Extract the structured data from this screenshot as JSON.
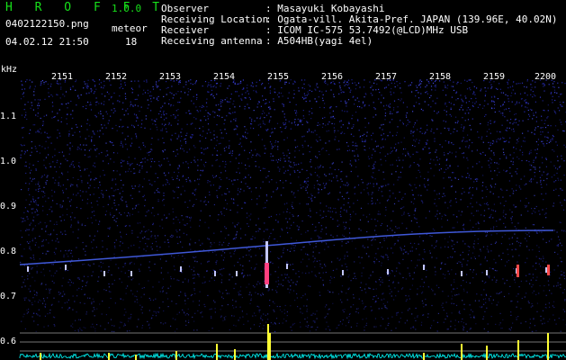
{
  "app": {
    "title": "H R O F F T",
    "version": "1.0.0"
  },
  "file": {
    "name": "0402122150.png",
    "datetime": "04.02.12 21:50"
  },
  "meteor": {
    "label": "meteor",
    "count": "18"
  },
  "info_rows": [
    {
      "key": "Observer",
      "value": ": Masayuki Kobayashi"
    },
    {
      "key": "Receiving Location",
      "value": ": Ogata-vill. Akita-Pref. JAPAN (139.96E, 40.02N)"
    },
    {
      "key": "Receiver",
      "value": ": ICOM IC-575 53.7492(@LCD)MHz USB"
    },
    {
      "key": "Receiving antenna",
      "value": ": A504HB(yagi 4el)"
    }
  ],
  "axes": {
    "y_unit": "kHz",
    "time_ticks": [
      "2151",
      "2152",
      "2153",
      "2154",
      "2155",
      "2156",
      "2157",
      "2158",
      "2159",
      "2200"
    ],
    "freq_ticks": [
      "1.1",
      "1.0",
      "0.9",
      "0.8",
      "0.7",
      "0.6"
    ]
  },
  "colors": {
    "noise": "#2a2fb0",
    "carrier": "#3f58d8",
    "trace": "#c4c8ff",
    "accent_green": "#17e01a",
    "peak": "#ffff33",
    "baseline": "#00ffff"
  }
}
